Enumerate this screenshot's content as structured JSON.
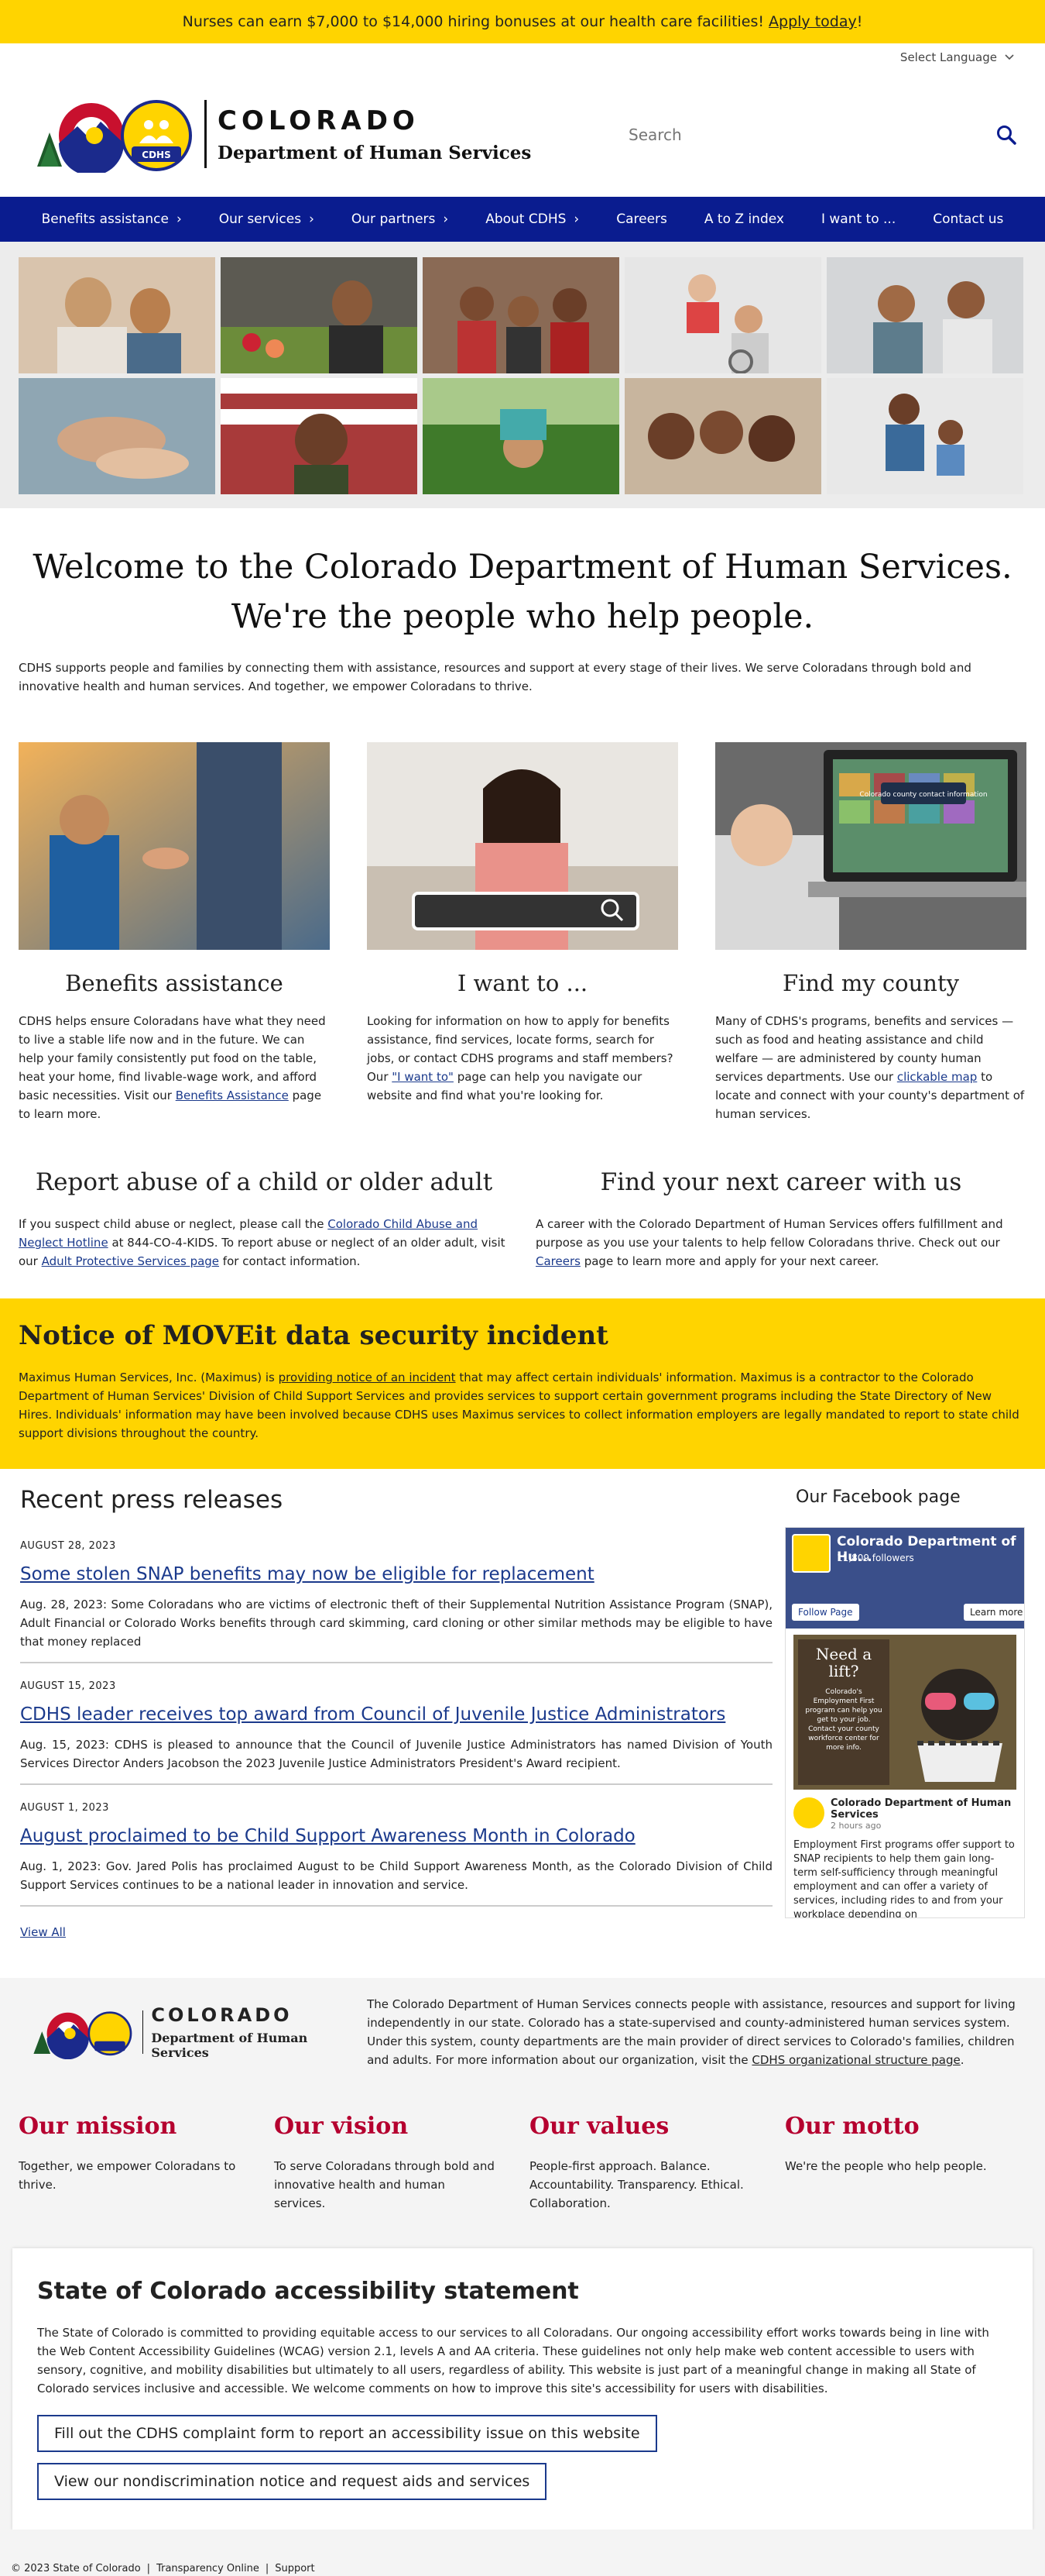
{
  "announcement": {
    "text": "Nurses can earn $7,000 to $14,000 hiring bonuses at our health care facilities!",
    "link": "Apply today",
    "suffix": "!"
  },
  "topbar": {
    "language": "Select Language"
  },
  "header": {
    "logo_state": "COLORADO",
    "logo_dept": "Department of Human Services",
    "logo_badge": "CDHS",
    "search_placeholder": "Search"
  },
  "nav": {
    "items": [
      {
        "label": "Benefits assistance",
        "chevron": "›"
      },
      {
        "label": "Our services",
        "chevron": "›"
      },
      {
        "label": "Our partners",
        "chevron": "›"
      },
      {
        "label": "About CDHS",
        "chevron": "›"
      },
      {
        "label": "Careers",
        "chevron": ""
      },
      {
        "label": "A to Z index",
        "chevron": ""
      },
      {
        "label": "I want to ...",
        "chevron": ""
      },
      {
        "label": "Contact us",
        "chevron": ""
      }
    ]
  },
  "welcome": {
    "line1": "Welcome to the Colorado Department of Human Services.",
    "line2": "We're the people who help people.",
    "intro": "CDHS supports people and families by connecting them with assistance, resources and support at every stage of their lives. We serve Coloradans through bold and innovative health and human services. And together, we empower Coloradans to thrive."
  },
  "cards": [
    {
      "title": "Benefits assistance",
      "text_before": "CDHS helps ensure Coloradans have what they need to live a stable life now and in the future. We can help your family consistently put food on the table, heat your home, find livable-wage work, and afford basic necessities. Visit our ",
      "link": "Benefits Assistance",
      "text_after": " page to learn more."
    },
    {
      "title": "I want to ...",
      "text_before": "Looking for information on how to apply for benefits assistance, find services, locate forms, search for jobs, or contact CDHS programs and staff members? Our ",
      "link": "\"I want to\"",
      "text_after": " page can help you navigate our website and find what you're looking for."
    },
    {
      "title": "Find my county",
      "text_before": "Many of CDHS's programs, benefits and services — such as food and heating assistance and child welfare — are administered by county human services departments. Use our ",
      "link": "clickable map",
      "text_after": " to locate and connect with your county's department of human services.",
      "laptop_caption": "Colorado county contact information"
    }
  ],
  "report": {
    "title": "Report abuse of a child or older adult",
    "t1": "If you suspect child abuse or neglect, please call the ",
    "link1": "Colorado Child Abuse and Neglect Hotline",
    "t2": " at 844-CO-4-KIDS. To report abuse or neglect of an older adult, visit our ",
    "link2": "Adult Protective Services page",
    "t3": " for contact information."
  },
  "career": {
    "title": "Find your next career with us",
    "t1": "A career with the Colorado Department of Human Services offers fulfillment and purpose as you use your talents to help fellow Coloradans thrive. Check out our ",
    "link": "Careers",
    "t2": " page to learn more and apply for your next career."
  },
  "notice": {
    "title": "Notice of MOVEit data security incident",
    "t1": "Maximus Human Services, Inc. (Maximus) is ",
    "link": "providing notice of an incident",
    "t2": " that may affect certain individuals' information. Maximus is a contractor to the Colorado Department of Human Services' Division of Child Support Services and provides services to support certain government programs including the State Directory of New Hires. Individuals' information may have been involved because CDHS uses Maximus services to collect information employers are legally mandated to report to state child support divisions throughout the country."
  },
  "press": {
    "heading": "Recent press releases",
    "items": [
      {
        "date": "AUGUST 28, 2023",
        "title": "Some stolen SNAP benefits may now be eligible for replacement",
        "summary": "Aug. 28, 2023: Some Coloradans who are victims of electronic theft of their Supplemental Nutrition Assistance Program (SNAP), Adult Financial or Colorado Works benefits through card skimming, card cloning or other similar methods may be eligible to have that money replaced"
      },
      {
        "date": "AUGUST 15, 2023",
        "title": "CDHS leader receives top award from Council of Juvenile Justice Administrators",
        "summary": "Aug. 15, 2023: CDHS is pleased to announce that the Council of Juvenile Justice Administrators has named Division of Youth Services Director Anders Jacobson the 2023 Juvenile Justice Administrators President's Award recipient."
      },
      {
        "date": "AUGUST 1, 2023",
        "title": "August proclaimed to be Child Support Awareness Month in Colorado",
        "summary": "Aug. 1, 2023: Gov. Jared Polis has proclaimed August to be Child Support Awareness Month, as the Colorado Division of Child Support Services continues to be a national leader in innovation and service."
      }
    ],
    "view_all": "View All"
  },
  "facebook": {
    "heading": "Our Facebook page",
    "page_name": "Colorado Department of Hu...",
    "followers": "11,809 followers",
    "follow_btn": "Follow Page",
    "learn_btn": "Learn more",
    "post_overlay_title": "Need a lift?",
    "post_overlay_text": "Colorado's Employment First program can help you get to your job. Contact your county workforce center for more info.",
    "post_author": "Colorado Department of Human Services",
    "post_time": "2 hours ago",
    "post_text": "Employment First programs offer support to SNAP recipients to help them gain long-term self-sufficiency through meaningful employment and can offer a variety of services, including rides to and from your workplace depending on"
  },
  "footer": {
    "about_text": "The Colorado Department of Human Services connects people with assistance, resources and support for living independently in our state. Colorado has a state-supervised and county-administered human services system. Under this system, county departments are the main provider of direct services to Colorado's families, children and adults. For more information about our organization, visit the ",
    "about_link": "CDHS organizational structure page",
    "about_end": ".",
    "values": [
      {
        "title": "Our mission",
        "text": "Together, we empower Coloradans to thrive."
      },
      {
        "title": "Our vision",
        "text": "To serve Coloradans through bold and innovative health and human services."
      },
      {
        "title": "Our values",
        "text": "People-first approach. Balance. Accountability. Transparency. Ethical. Collaboration."
      },
      {
        "title": "Our motto",
        "text": "We're the people who help people."
      }
    ]
  },
  "accessibility": {
    "title": "State of Colorado accessibility statement",
    "p1": "The State of Colorado is committed to providing equitable access to our services to all Coloradans. Our ongoing accessibility effort works towards being in line with the Web Content Accessibility Guidelines (WCAG) version 2.1, levels A and AA criteria. These guidelines not only help make web content accessible to users with sensory, cognitive, and mobility disabilities but ultimately to all users, regardless of ability. This website is just part of a meaningful change in making all State of Colorado services inclusive and accessible. We welcome comments on how to improve this site's accessibility for users with disabilities.",
    "btn1": "Fill out the CDHS complaint form to report an accessibility issue on this website",
    "btn2": "View our nondiscrimination notice and request aids and services"
  },
  "bottom": {
    "copyright": "© 2023 State of Colorado",
    "sep1": "|",
    "link1": "Transparency Online",
    "sep2": "|",
    "link2": "Support"
  },
  "colors": {
    "announce": "#ffd400",
    "nav": "#0a1c8f",
    "link": "#1b3a8c",
    "value_title": "#b5002f"
  }
}
